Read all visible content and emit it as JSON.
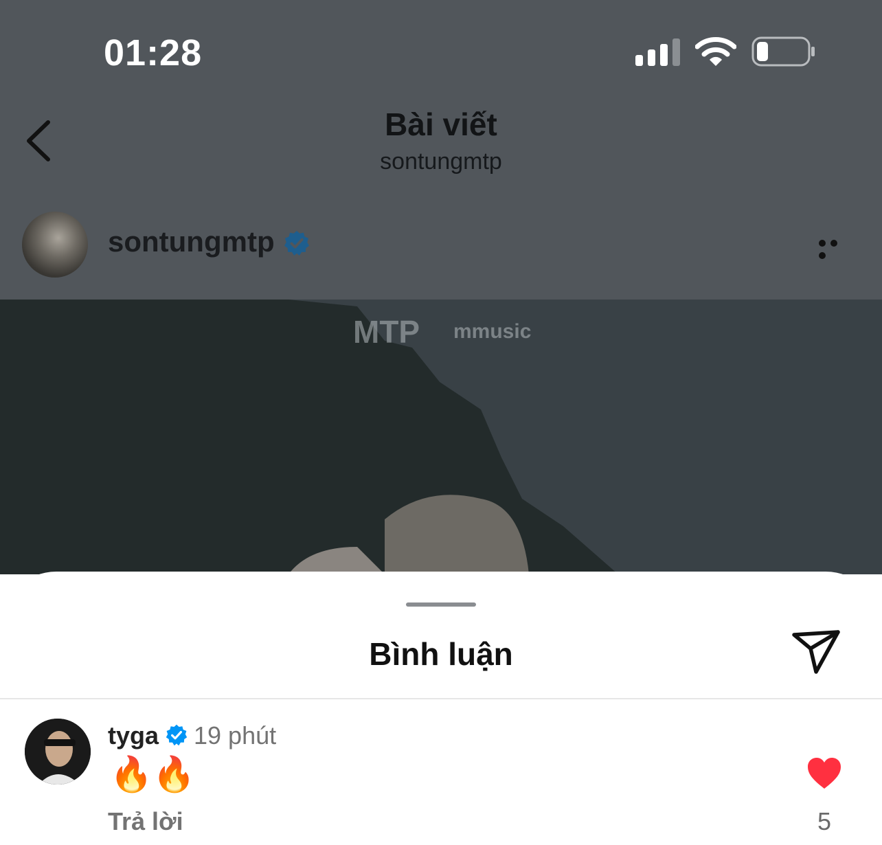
{
  "status_bar": {
    "time": "01:28"
  },
  "header": {
    "title": "Bài viết",
    "subtitle": "sontungmtp"
  },
  "post": {
    "username": "sontungmtp",
    "watermark_left": "MTP",
    "watermark_right": "mmusic"
  },
  "comments_sheet": {
    "title": "Bình luận",
    "comments": [
      {
        "username": "tyga",
        "time": "19 phút",
        "text": "🔥🔥",
        "reply_label": "Trả lời",
        "like_count": "5"
      }
    ]
  },
  "colors": {
    "verified": "#0095f6",
    "like": "#ff3040"
  }
}
